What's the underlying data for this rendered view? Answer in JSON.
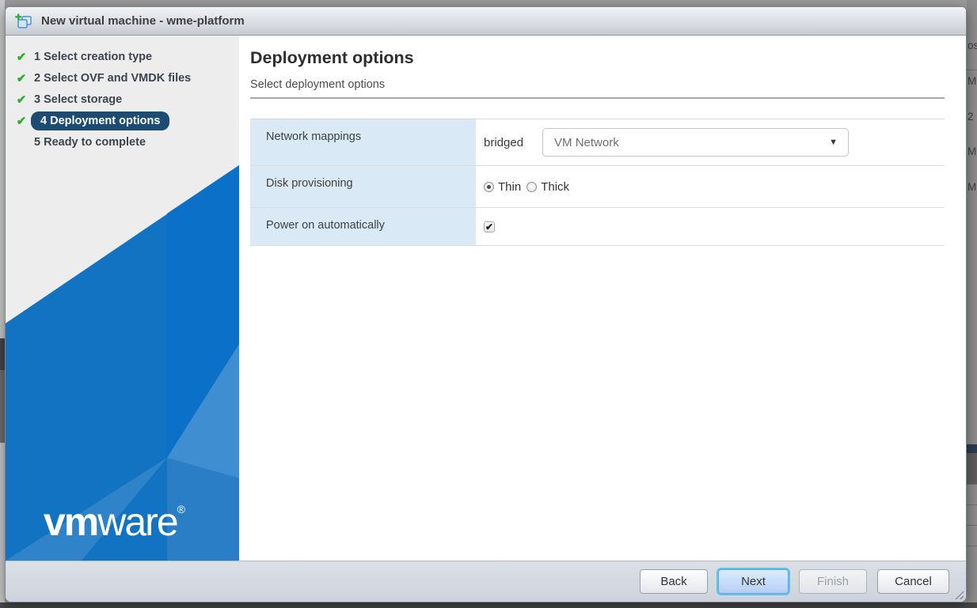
{
  "window": {
    "title": "New virtual machine - wme-platform"
  },
  "sidebar": {
    "steps": [
      {
        "label": "1 Select creation type",
        "done": true,
        "active": false
      },
      {
        "label": "2 Select OVF and VMDK files",
        "done": true,
        "active": false
      },
      {
        "label": "3 Select storage",
        "done": true,
        "active": false
      },
      {
        "label": "4 Deployment options",
        "done": true,
        "active": true
      },
      {
        "label": "5 Ready to complete",
        "done": false,
        "active": false
      }
    ],
    "logo": {
      "bold": "vm",
      "light": "ware",
      "registered": "®"
    }
  },
  "main": {
    "title": "Deployment options",
    "subtitle": "Select deployment options",
    "network_row": {
      "label": "Network mappings",
      "key_label": "bridged",
      "selected_option": "VM Network"
    },
    "disk_row": {
      "label": "Disk provisioning",
      "thin_label": "Thin",
      "thick_label": "Thick",
      "selected": "Thin"
    },
    "power_row": {
      "label": "Power on automatically",
      "checked": true
    }
  },
  "footer": {
    "back_label": "Back",
    "next_label": "Next",
    "finish_label": "Finish",
    "cancel_label": "Cancel"
  },
  "background": {
    "fragments": [
      "os",
      "M",
      "2",
      "M",
      "M"
    ]
  },
  "icons": {
    "checkmark": "✔",
    "dropdown_arrow": "▼",
    "plus": "✚"
  },
  "colors": {
    "accent_blue": "#1273c2",
    "active_step_bg": "#1d4b73",
    "label_cell_bg": "#d9eaf6",
    "check_green": "#2cac33",
    "next_focus_ring": "#5ec1ec"
  }
}
